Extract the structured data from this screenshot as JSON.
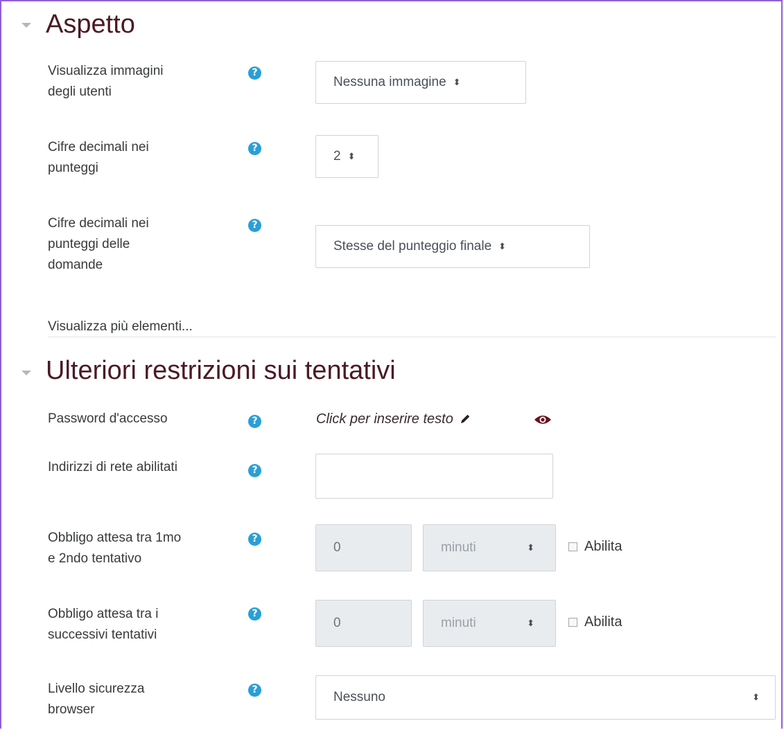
{
  "sections": {
    "appearance": {
      "title": "Aspetto"
    },
    "restrictions": {
      "title": "Ulteriori restrizioni sui tentativi"
    }
  },
  "fields": {
    "user_images": {
      "label_line1": "Visualizza immagini",
      "label_line2": "degli utenti",
      "value": "Nessuna immagine"
    },
    "decimal_places": {
      "label_line1": "Cifre decimali nei",
      "label_line2": "punteggi",
      "value": "2"
    },
    "question_decimals": {
      "label_line1": "Cifre decimali nei",
      "label_line2": "punteggi delle",
      "label_line3": "domande",
      "value": "Stesse del punteggio finale"
    },
    "show_more": "Visualizza più elementi...",
    "password": {
      "label": "Password d'accesso",
      "placeholder": "Click per inserire testo"
    },
    "network": {
      "label": "Indirizzi di rete abilitati",
      "value": ""
    },
    "delay1": {
      "label_line1": "Obbligo attesa tra 1mo",
      "label_line2": "e 2ndo tentativo",
      "number": "0",
      "unit": "minuti",
      "enable_label": "Abilita"
    },
    "delay2": {
      "label_line1": "Obbligo attesa tra i",
      "label_line2": "successivi tentativi",
      "number": "0",
      "unit": "minuti",
      "enable_label": "Abilita"
    },
    "browser_security": {
      "label_line1": "Livello sicurezza",
      "label_line2": "browser",
      "value": "Nessuno"
    }
  },
  "icons": {
    "help": "help-circle-icon",
    "select_arrows": "sort-arrows-icon",
    "edit": "pencil-icon",
    "reveal": "eye-icon"
  },
  "colors": {
    "accent_border": "#8f5fd6",
    "help_icon": "#2a9fd6",
    "section_title": "#4a1a24"
  }
}
